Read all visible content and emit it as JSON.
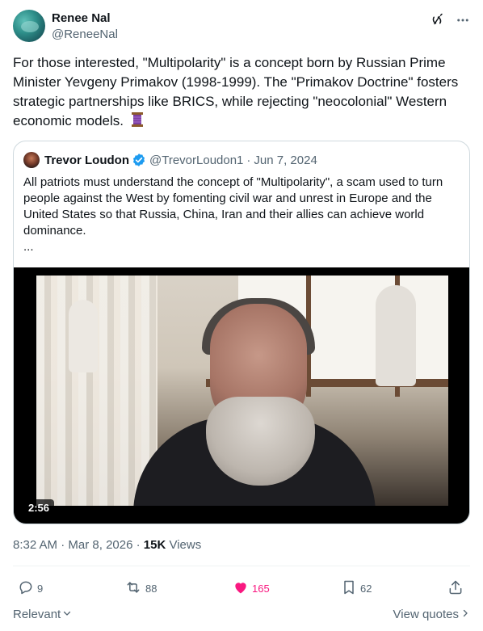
{
  "author": {
    "name": "Renee Nal",
    "handle": "@ReneeNal"
  },
  "post": {
    "text": "For those interested, \"Multipolarity\" is a concept born by Russian Prime Minister Yevgeny Primakov (1998-1999). The \"Primakov Doctrine\" fosters strategic partnerships like BRICS, while rejecting \"neocolonial\" Western economic models.",
    "emoji_icon": "thread-spool-icon"
  },
  "quote": {
    "name": "Trevor Loudon",
    "handle": "@TrevorLoudon1",
    "date_sep": "·",
    "date": "Jun 7, 2024",
    "text": "All patriots must understand the concept of \"Multipolarity\", a scam used to turn people against the West by fomenting civil war and unrest in Europe and the United States so that Russia, China, Iran and their allies can achieve world dominance.",
    "more": "...",
    "video_duration": "2:56"
  },
  "meta": {
    "time": "8:32 AM",
    "sep1": "·",
    "date": "Mar 8, 2026",
    "sep2": "·",
    "views_count": "15K",
    "views_label": "Views"
  },
  "actions": {
    "replies": "9",
    "reposts": "88",
    "likes": "165",
    "bookmarks": "62"
  },
  "footer": {
    "sort_label": "Relevant",
    "view_quotes_label": "View quotes"
  },
  "colors": {
    "like_active": "#f91880",
    "secondary_text": "#536471",
    "verified": "#1d9bf0"
  }
}
